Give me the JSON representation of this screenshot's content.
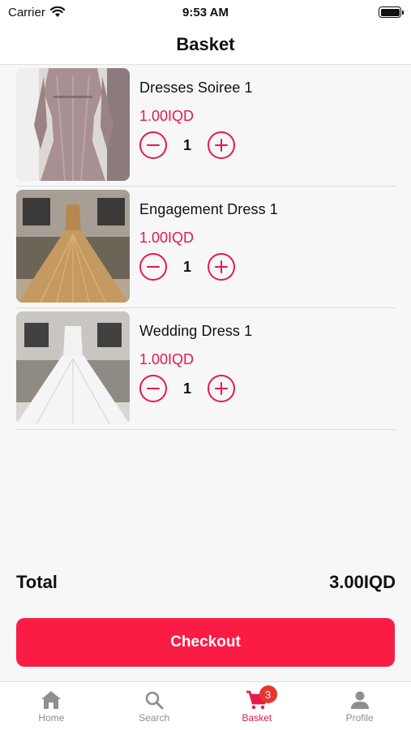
{
  "status_bar": {
    "carrier": "Carrier",
    "time": "9:53 AM"
  },
  "header": {
    "title": "Basket"
  },
  "colors": {
    "accent": "#e8194a",
    "checkout": "#fb1c46",
    "badge": "#e8362f"
  },
  "items": [
    {
      "name": "Dresses Soiree 1",
      "price": "1.00IQD",
      "quantity": "1",
      "image_icon": "pink-sequin-dress-photo"
    },
    {
      "name": "Engagement Dress  1",
      "price": "1.00IQD",
      "quantity": "1",
      "image_icon": "gold-ball-gown-photo"
    },
    {
      "name": "Wedding Dress  1",
      "price": "1.00IQD",
      "quantity": "1",
      "image_icon": "white-wedding-gown-photo"
    }
  ],
  "summary": {
    "total_label": "Total",
    "total_value": "3.00IQD"
  },
  "checkout": {
    "label": "Checkout"
  },
  "tabs": [
    {
      "label": "Home",
      "icon": "home-icon"
    },
    {
      "label": "Search",
      "icon": "search-icon"
    },
    {
      "label": "Basket",
      "icon": "cart-icon",
      "active": true,
      "badge": "3"
    },
    {
      "label": "Profile",
      "icon": "person-icon"
    }
  ]
}
